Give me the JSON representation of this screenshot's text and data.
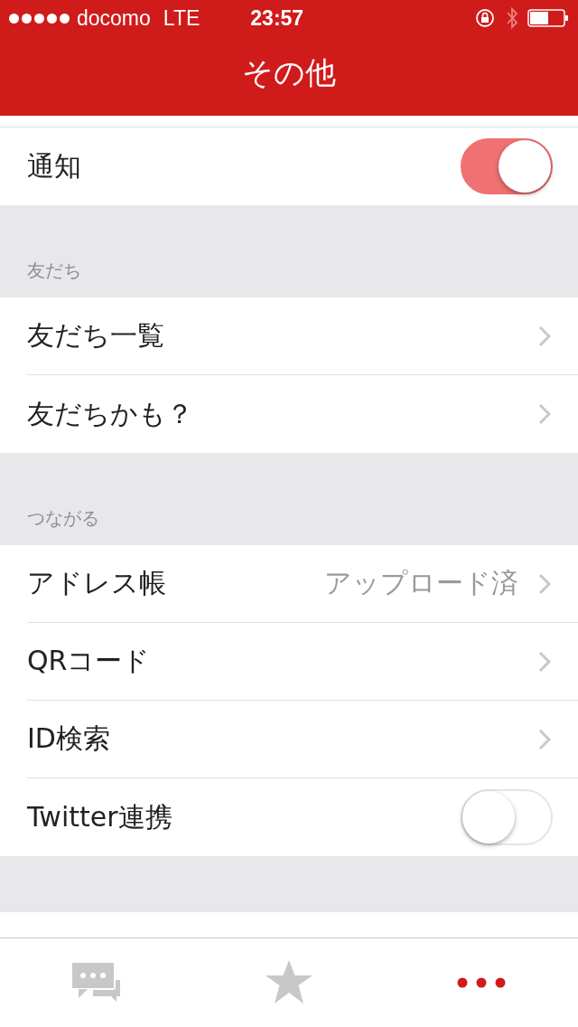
{
  "status_bar": {
    "carrier": "docomo",
    "network": "LTE",
    "time": "23:57"
  },
  "nav": {
    "title": "その他"
  },
  "sections": [
    {
      "rows": [
        {
          "kind": "toggle",
          "label": "通知",
          "on": true
        }
      ]
    },
    {
      "header": "友だち",
      "rows": [
        {
          "kind": "link",
          "label": "友だち一覧"
        },
        {
          "kind": "link",
          "label": "友だちかも？"
        }
      ]
    },
    {
      "header": "つながる",
      "rows": [
        {
          "kind": "link",
          "label": "アドレス帳",
          "detail": "アップロード済"
        },
        {
          "kind": "link",
          "label": "QRコード"
        },
        {
          "kind": "link",
          "label": "ID検索"
        },
        {
          "kind": "toggle",
          "label": "Twitter連携",
          "on": false
        }
      ]
    }
  ],
  "tabs": [
    {
      "kind": "chat",
      "selected": false
    },
    {
      "kind": "star",
      "selected": false
    },
    {
      "kind": "more",
      "selected": true
    }
  ]
}
